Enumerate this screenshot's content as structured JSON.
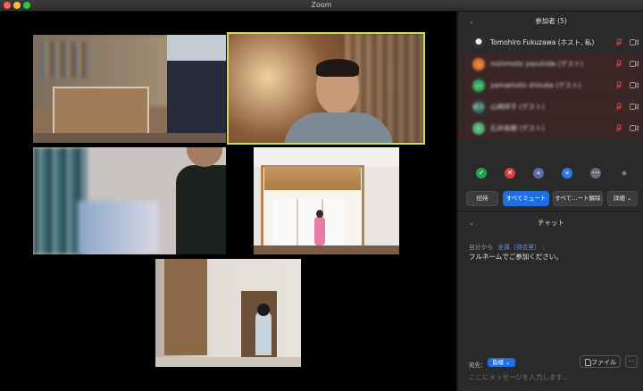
{
  "window": {
    "title": "Zoom"
  },
  "participants": {
    "header": "参加者 (5)",
    "list": [
      {
        "name": "Tomohiro Fukuzawa (ホスト, 私)",
        "initials": "",
        "color": "#555555",
        "blurred": false
      },
      {
        "name": "nishimoto yasuhide (ゲスト)",
        "initials": "ry",
        "color": "#e0742b",
        "blurred": true
      },
      {
        "name": "yamamoto shisuke (ゲスト)",
        "initials": "ya",
        "color": "#2eaa5a",
        "blurred": true
      },
      {
        "name": "山崎祥子 (ゲスト)",
        "initials": "崎子",
        "color": "#2f6f5f",
        "blurred": true
      },
      {
        "name": "石井裕樹 (ゲスト)",
        "initials": "石",
        "color": "#4caf70",
        "blurred": true
      }
    ]
  },
  "controls": {
    "invite": "招待",
    "mute_all": "すべてミュート",
    "unmute_all": "すべて…ート解除",
    "details": "詳細"
  },
  "reactions": [
    {
      "icon": "check-icon",
      "glyph": "✓",
      "color": "#22a34a"
    },
    {
      "icon": "x-icon",
      "glyph": "✕",
      "color": "#e03a3a"
    },
    {
      "icon": "rewind-icon",
      "glyph": "«",
      "color": "#5b6aa8"
    },
    {
      "icon": "fast-forward-icon",
      "glyph": "»",
      "color": "#2d7be3"
    },
    {
      "icon": "more-reactions-icon",
      "glyph": "•••",
      "color": "#6a6a7a"
    },
    {
      "icon": "clear-icon",
      "glyph": "◆",
      "color": "#7a7a7a"
    }
  ],
  "chat": {
    "header": "チャット",
    "meta_from": "自分から",
    "meta_to": "全員（待合室）",
    "meta_suffix": "：",
    "message": "フルネームでご参加ください。",
    "to_label": "宛先：",
    "to_value": "皆様",
    "file_button": "ファイル",
    "input_placeholder": "ここにメッセージを入力します..."
  },
  "colors": {
    "active_speaker": "#c8e05a",
    "accent": "#1f6fe0",
    "mic_muted": "#d13b3b"
  }
}
